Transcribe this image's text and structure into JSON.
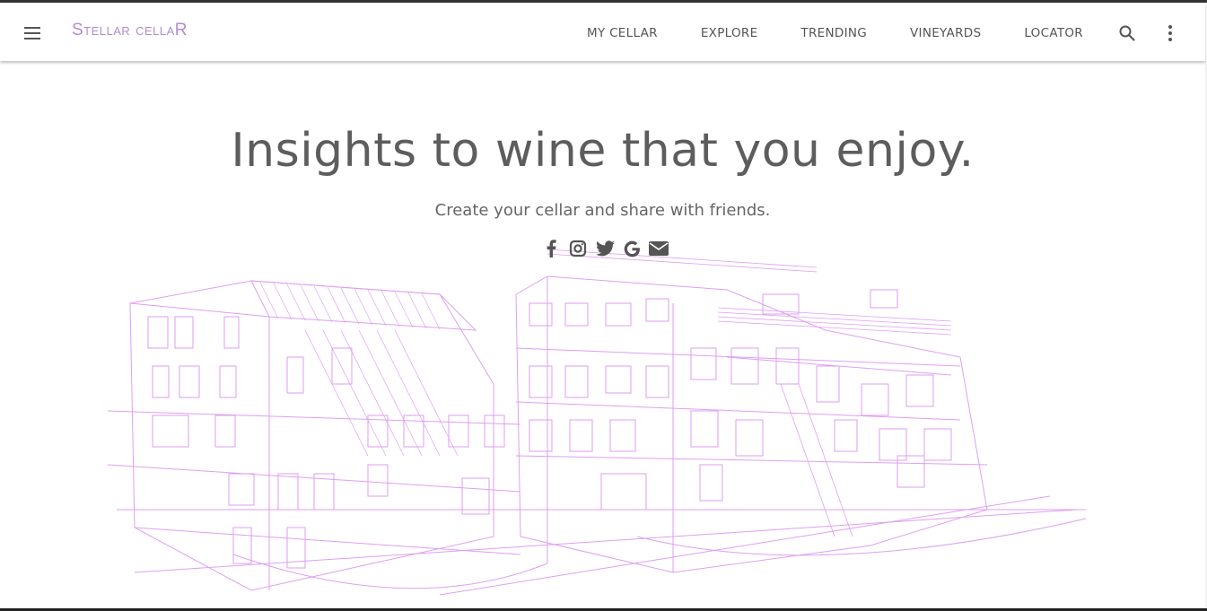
{
  "header": {
    "brand": "Stellar cellaR",
    "nav": [
      "MY CELLAR",
      "EXPLORE",
      "TRENDING",
      "VINEYARDS",
      "LOCATOR"
    ]
  },
  "hero": {
    "title": "Insights to wine that you enjoy.",
    "subtitle": "Create your cellar and share with friends."
  },
  "social": [
    "facebook-icon",
    "instagram-icon",
    "twitter-icon",
    "google-icon",
    "email-icon"
  ],
  "colors": {
    "brand": "#b48ad4",
    "sketch": "#d98ef0",
    "text": "#5d5d5d"
  }
}
